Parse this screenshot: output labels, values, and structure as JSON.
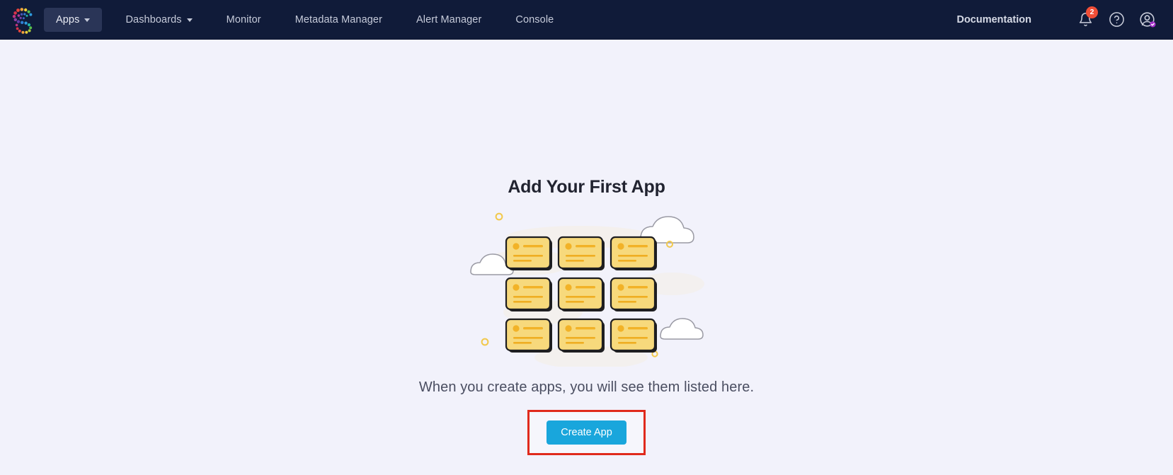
{
  "header": {
    "logo_name": "datadog-logo",
    "nav_items": [
      {
        "label": "Apps",
        "icon": "chevron-down-icon",
        "has_caret": true,
        "active": true,
        "name": "nav-apps"
      },
      {
        "label": "Dashboards",
        "icon": "chevron-down-icon",
        "has_caret": true,
        "active": false,
        "name": "nav-dashboards"
      },
      {
        "label": "Monitor",
        "has_caret": false,
        "active": false,
        "name": "nav-monitor"
      },
      {
        "label": "Metadata Manager",
        "has_caret": false,
        "active": false,
        "name": "nav-metadata-manager"
      },
      {
        "label": "Alert Manager",
        "has_caret": false,
        "active": false,
        "name": "nav-alert-manager"
      },
      {
        "label": "Console",
        "has_caret": false,
        "active": false,
        "name": "nav-console"
      }
    ],
    "documentation_label": "Documentation",
    "notifications": {
      "icon": "bell-icon",
      "badge_count": "2",
      "badge_color": "#F04E37"
    },
    "help": {
      "icon": "help-circle-icon"
    },
    "account": {
      "icon": "user-account-icon",
      "badge_color": "#A32FC9"
    },
    "background_color": "#101B39",
    "active_item_color": "#2A3557"
  },
  "main": {
    "title": "Add Your First App",
    "subtitle": "When you create apps, you will see them listed here.",
    "background_color": "#F2F2FB",
    "illustration": {
      "name": "empty-apps-illustration",
      "card_count": 9,
      "card_fill": "#F7D97C",
      "card_stroke": "#1E1E21",
      "accent": "#F2B227",
      "cloud_fill": "#FFFFFF",
      "cloud_stroke": "#9A9AA4"
    },
    "cta": {
      "label": "Create App",
      "color": "#19A6DC",
      "text_color": "#FFFFFF",
      "highlight_border_color": "#E02A1C"
    }
  }
}
